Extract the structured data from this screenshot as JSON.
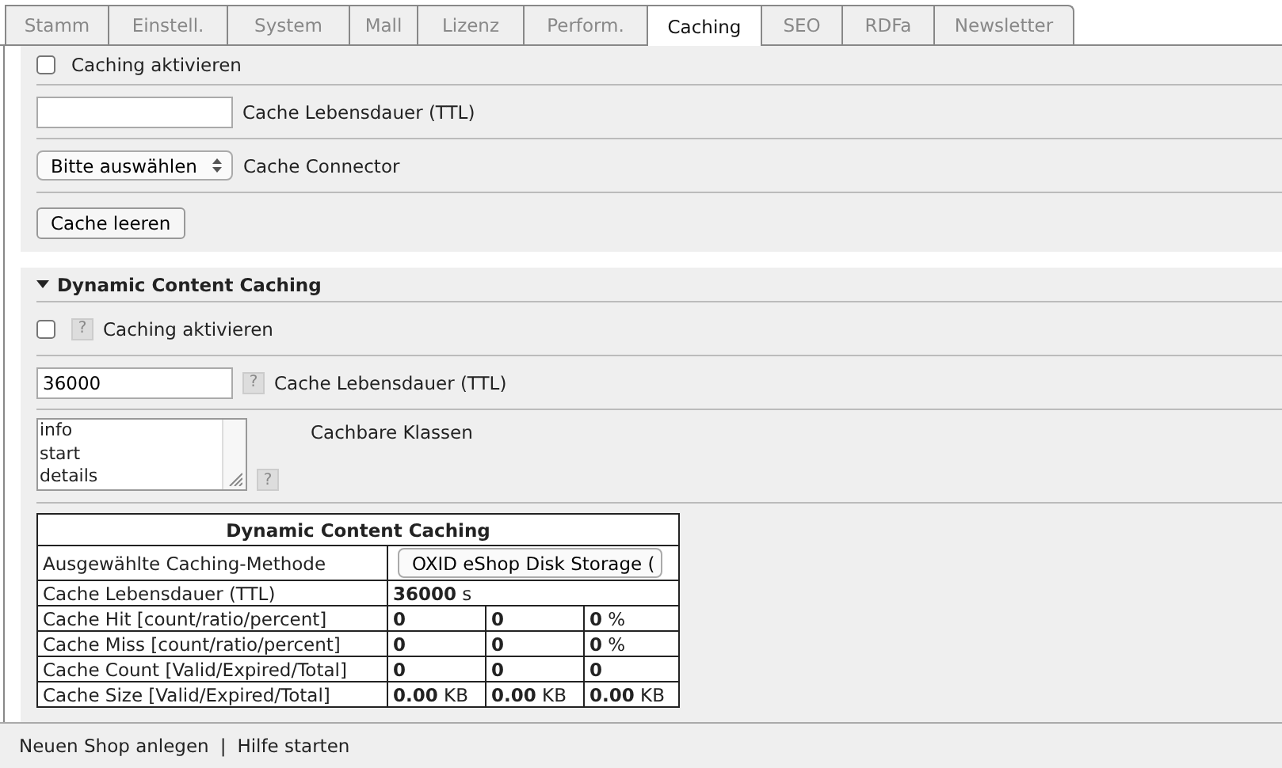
{
  "tabs": [
    {
      "label": "Stamm",
      "selected": false
    },
    {
      "label": "Einstell.",
      "selected": false
    },
    {
      "label": "System",
      "selected": false
    },
    {
      "label": "Mall",
      "selected": false
    },
    {
      "label": "Lizenz",
      "selected": false
    },
    {
      "label": "Perform.",
      "selected": false
    },
    {
      "label": "Caching",
      "selected": true
    },
    {
      "label": "SEO",
      "selected": false
    },
    {
      "label": "RDFa",
      "selected": false
    },
    {
      "label": "Newsletter",
      "selected": false
    }
  ],
  "general": {
    "activate": {
      "label": "Caching aktivieren",
      "checked": false
    },
    "ttl": {
      "label": "Cache Lebensdauer (TTL)"
    },
    "connector": {
      "value": "Bitte auswählen",
      "label": "Cache Connector"
    },
    "clear_button": "Cache leeren"
  },
  "dynamic": {
    "title": "Dynamic Content Caching",
    "expanded": true,
    "activate": {
      "label": "Caching aktivieren",
      "checked": false,
      "help": "?"
    },
    "ttl": {
      "value": "36000",
      "label": "Cache Lebensdauer (TTL)",
      "help": "?"
    },
    "classes": {
      "lines": [
        "info",
        "start",
        "details"
      ],
      "label": "Cachbare Klassen",
      "help": "?"
    },
    "stats": {
      "title": "Dynamic Content Caching",
      "rows": [
        {
          "kind": "select",
          "label": "Ausgewählte Caching-Methode",
          "value": "OXID eShop Disk Storage ("
        },
        {
          "kind": "single",
          "label": "Cache Lebensdauer (TTL)",
          "value": "**36000** s"
        },
        {
          "kind": "triple",
          "label": "Cache Hit [count/ratio/percent]",
          "cells": [
            "**0**",
            "**0**",
            "**0** %"
          ]
        },
        {
          "kind": "triple",
          "label": "Cache Miss [count/ratio/percent]",
          "cells": [
            "**0**",
            "**0**",
            "**0** %"
          ]
        },
        {
          "kind": "triple",
          "label": "Cache Count [Valid/Expired/Total]",
          "cells": [
            "**0**",
            "**0**",
            "**0**"
          ]
        },
        {
          "kind": "triple",
          "label": "Cache Size [Valid/Expired/Total]",
          "cells": [
            "**0.00** KB",
            "**0.00** KB",
            "**0.00** KB"
          ]
        }
      ]
    }
  },
  "footer": {
    "links": [
      "Neuen Shop anlegen",
      "Hilfe starten"
    ],
    "separator": "|"
  }
}
